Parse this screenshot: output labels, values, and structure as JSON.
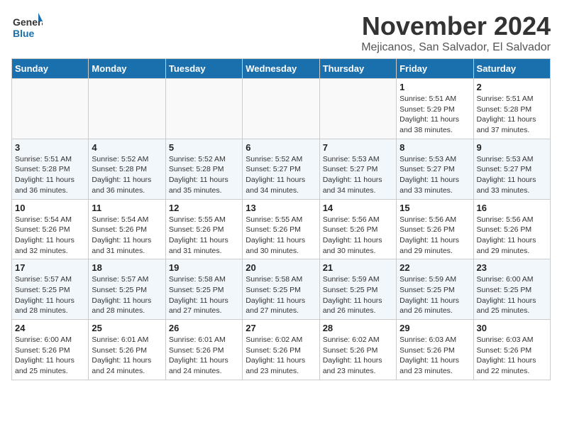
{
  "logo": {
    "text_general": "General",
    "text_blue": "Blue"
  },
  "title": "November 2024",
  "location": "Mejicanos, San Salvador, El Salvador",
  "weekdays": [
    "Sunday",
    "Monday",
    "Tuesday",
    "Wednesday",
    "Thursday",
    "Friday",
    "Saturday"
  ],
  "weeks": [
    [
      {
        "day": "",
        "info": ""
      },
      {
        "day": "",
        "info": ""
      },
      {
        "day": "",
        "info": ""
      },
      {
        "day": "",
        "info": ""
      },
      {
        "day": "",
        "info": ""
      },
      {
        "day": "1",
        "info": "Sunrise: 5:51 AM\nSunset: 5:29 PM\nDaylight: 11 hours\nand 38 minutes."
      },
      {
        "day": "2",
        "info": "Sunrise: 5:51 AM\nSunset: 5:28 PM\nDaylight: 11 hours\nand 37 minutes."
      }
    ],
    [
      {
        "day": "3",
        "info": "Sunrise: 5:51 AM\nSunset: 5:28 PM\nDaylight: 11 hours\nand 36 minutes."
      },
      {
        "day": "4",
        "info": "Sunrise: 5:52 AM\nSunset: 5:28 PM\nDaylight: 11 hours\nand 36 minutes."
      },
      {
        "day": "5",
        "info": "Sunrise: 5:52 AM\nSunset: 5:28 PM\nDaylight: 11 hours\nand 35 minutes."
      },
      {
        "day": "6",
        "info": "Sunrise: 5:52 AM\nSunset: 5:27 PM\nDaylight: 11 hours\nand 34 minutes."
      },
      {
        "day": "7",
        "info": "Sunrise: 5:53 AM\nSunset: 5:27 PM\nDaylight: 11 hours\nand 34 minutes."
      },
      {
        "day": "8",
        "info": "Sunrise: 5:53 AM\nSunset: 5:27 PM\nDaylight: 11 hours\nand 33 minutes."
      },
      {
        "day": "9",
        "info": "Sunrise: 5:53 AM\nSunset: 5:27 PM\nDaylight: 11 hours\nand 33 minutes."
      }
    ],
    [
      {
        "day": "10",
        "info": "Sunrise: 5:54 AM\nSunset: 5:26 PM\nDaylight: 11 hours\nand 32 minutes."
      },
      {
        "day": "11",
        "info": "Sunrise: 5:54 AM\nSunset: 5:26 PM\nDaylight: 11 hours\nand 31 minutes."
      },
      {
        "day": "12",
        "info": "Sunrise: 5:55 AM\nSunset: 5:26 PM\nDaylight: 11 hours\nand 31 minutes."
      },
      {
        "day": "13",
        "info": "Sunrise: 5:55 AM\nSunset: 5:26 PM\nDaylight: 11 hours\nand 30 minutes."
      },
      {
        "day": "14",
        "info": "Sunrise: 5:56 AM\nSunset: 5:26 PM\nDaylight: 11 hours\nand 30 minutes."
      },
      {
        "day": "15",
        "info": "Sunrise: 5:56 AM\nSunset: 5:26 PM\nDaylight: 11 hours\nand 29 minutes."
      },
      {
        "day": "16",
        "info": "Sunrise: 5:56 AM\nSunset: 5:26 PM\nDaylight: 11 hours\nand 29 minutes."
      }
    ],
    [
      {
        "day": "17",
        "info": "Sunrise: 5:57 AM\nSunset: 5:25 PM\nDaylight: 11 hours\nand 28 minutes."
      },
      {
        "day": "18",
        "info": "Sunrise: 5:57 AM\nSunset: 5:25 PM\nDaylight: 11 hours\nand 28 minutes."
      },
      {
        "day": "19",
        "info": "Sunrise: 5:58 AM\nSunset: 5:25 PM\nDaylight: 11 hours\nand 27 minutes."
      },
      {
        "day": "20",
        "info": "Sunrise: 5:58 AM\nSunset: 5:25 PM\nDaylight: 11 hours\nand 27 minutes."
      },
      {
        "day": "21",
        "info": "Sunrise: 5:59 AM\nSunset: 5:25 PM\nDaylight: 11 hours\nand 26 minutes."
      },
      {
        "day": "22",
        "info": "Sunrise: 5:59 AM\nSunset: 5:25 PM\nDaylight: 11 hours\nand 26 minutes."
      },
      {
        "day": "23",
        "info": "Sunrise: 6:00 AM\nSunset: 5:25 PM\nDaylight: 11 hours\nand 25 minutes."
      }
    ],
    [
      {
        "day": "24",
        "info": "Sunrise: 6:00 AM\nSunset: 5:26 PM\nDaylight: 11 hours\nand 25 minutes."
      },
      {
        "day": "25",
        "info": "Sunrise: 6:01 AM\nSunset: 5:26 PM\nDaylight: 11 hours\nand 24 minutes."
      },
      {
        "day": "26",
        "info": "Sunrise: 6:01 AM\nSunset: 5:26 PM\nDaylight: 11 hours\nand 24 minutes."
      },
      {
        "day": "27",
        "info": "Sunrise: 6:02 AM\nSunset: 5:26 PM\nDaylight: 11 hours\nand 23 minutes."
      },
      {
        "day": "28",
        "info": "Sunrise: 6:02 AM\nSunset: 5:26 PM\nDaylight: 11 hours\nand 23 minutes."
      },
      {
        "day": "29",
        "info": "Sunrise: 6:03 AM\nSunset: 5:26 PM\nDaylight: 11 hours\nand 23 minutes."
      },
      {
        "day": "30",
        "info": "Sunrise: 6:03 AM\nSunset: 5:26 PM\nDaylight: 11 hours\nand 22 minutes."
      }
    ]
  ]
}
